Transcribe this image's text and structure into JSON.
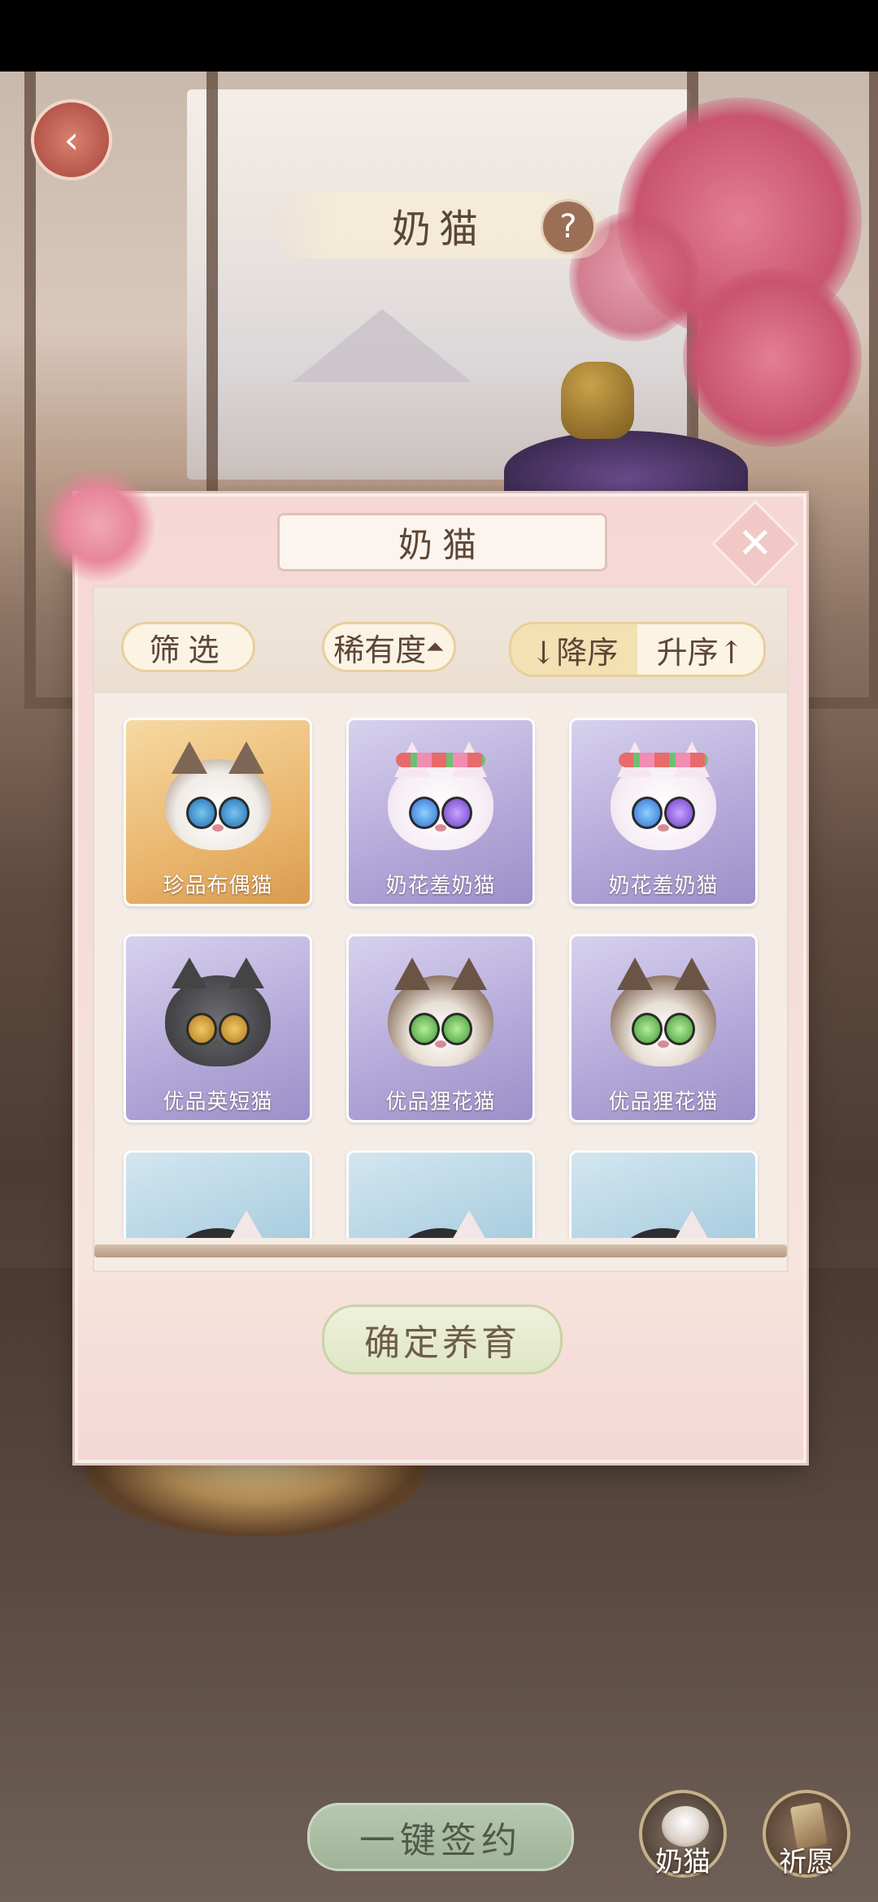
{
  "header": {
    "title": "奶猫",
    "help_symbol": "?",
    "back_symbol": "‹"
  },
  "modal": {
    "title": "奶猫",
    "close_symbol": "✕",
    "toolbar": {
      "filter_label": "筛选",
      "rarity_label": "稀有度",
      "rarity_indicator": "⏶",
      "sort_desc_label": "↓降序",
      "sort_asc_label": "升序↑"
    },
    "cards": [
      {
        "name": "珍品布偶猫",
        "tier": "gold"
      },
      {
        "name": "奶花羞奶猫",
        "tier": "purple"
      },
      {
        "name": "奶花羞奶猫",
        "tier": "purple"
      },
      {
        "name": "优品英短猫",
        "tier": "purple"
      },
      {
        "name": "优品狸花猫",
        "tier": "purple"
      },
      {
        "name": "优品狸花猫",
        "tier": "purple"
      },
      {
        "name": "",
        "tier": "blue"
      },
      {
        "name": "",
        "tier": "blue"
      },
      {
        "name": "",
        "tier": "blue"
      }
    ],
    "confirm_label": "确定养育"
  },
  "bottom": {
    "sign_all_label": "一键签约",
    "cat_button_label": "奶猫",
    "wish_button_label": "祈愿"
  },
  "colors": {
    "gold_card": "#eab66e",
    "purple_card": "#b3a7d8",
    "blue_card": "#a9cde0",
    "modal_bg": "#f4dcd8",
    "text_brown": "#5d4636"
  }
}
